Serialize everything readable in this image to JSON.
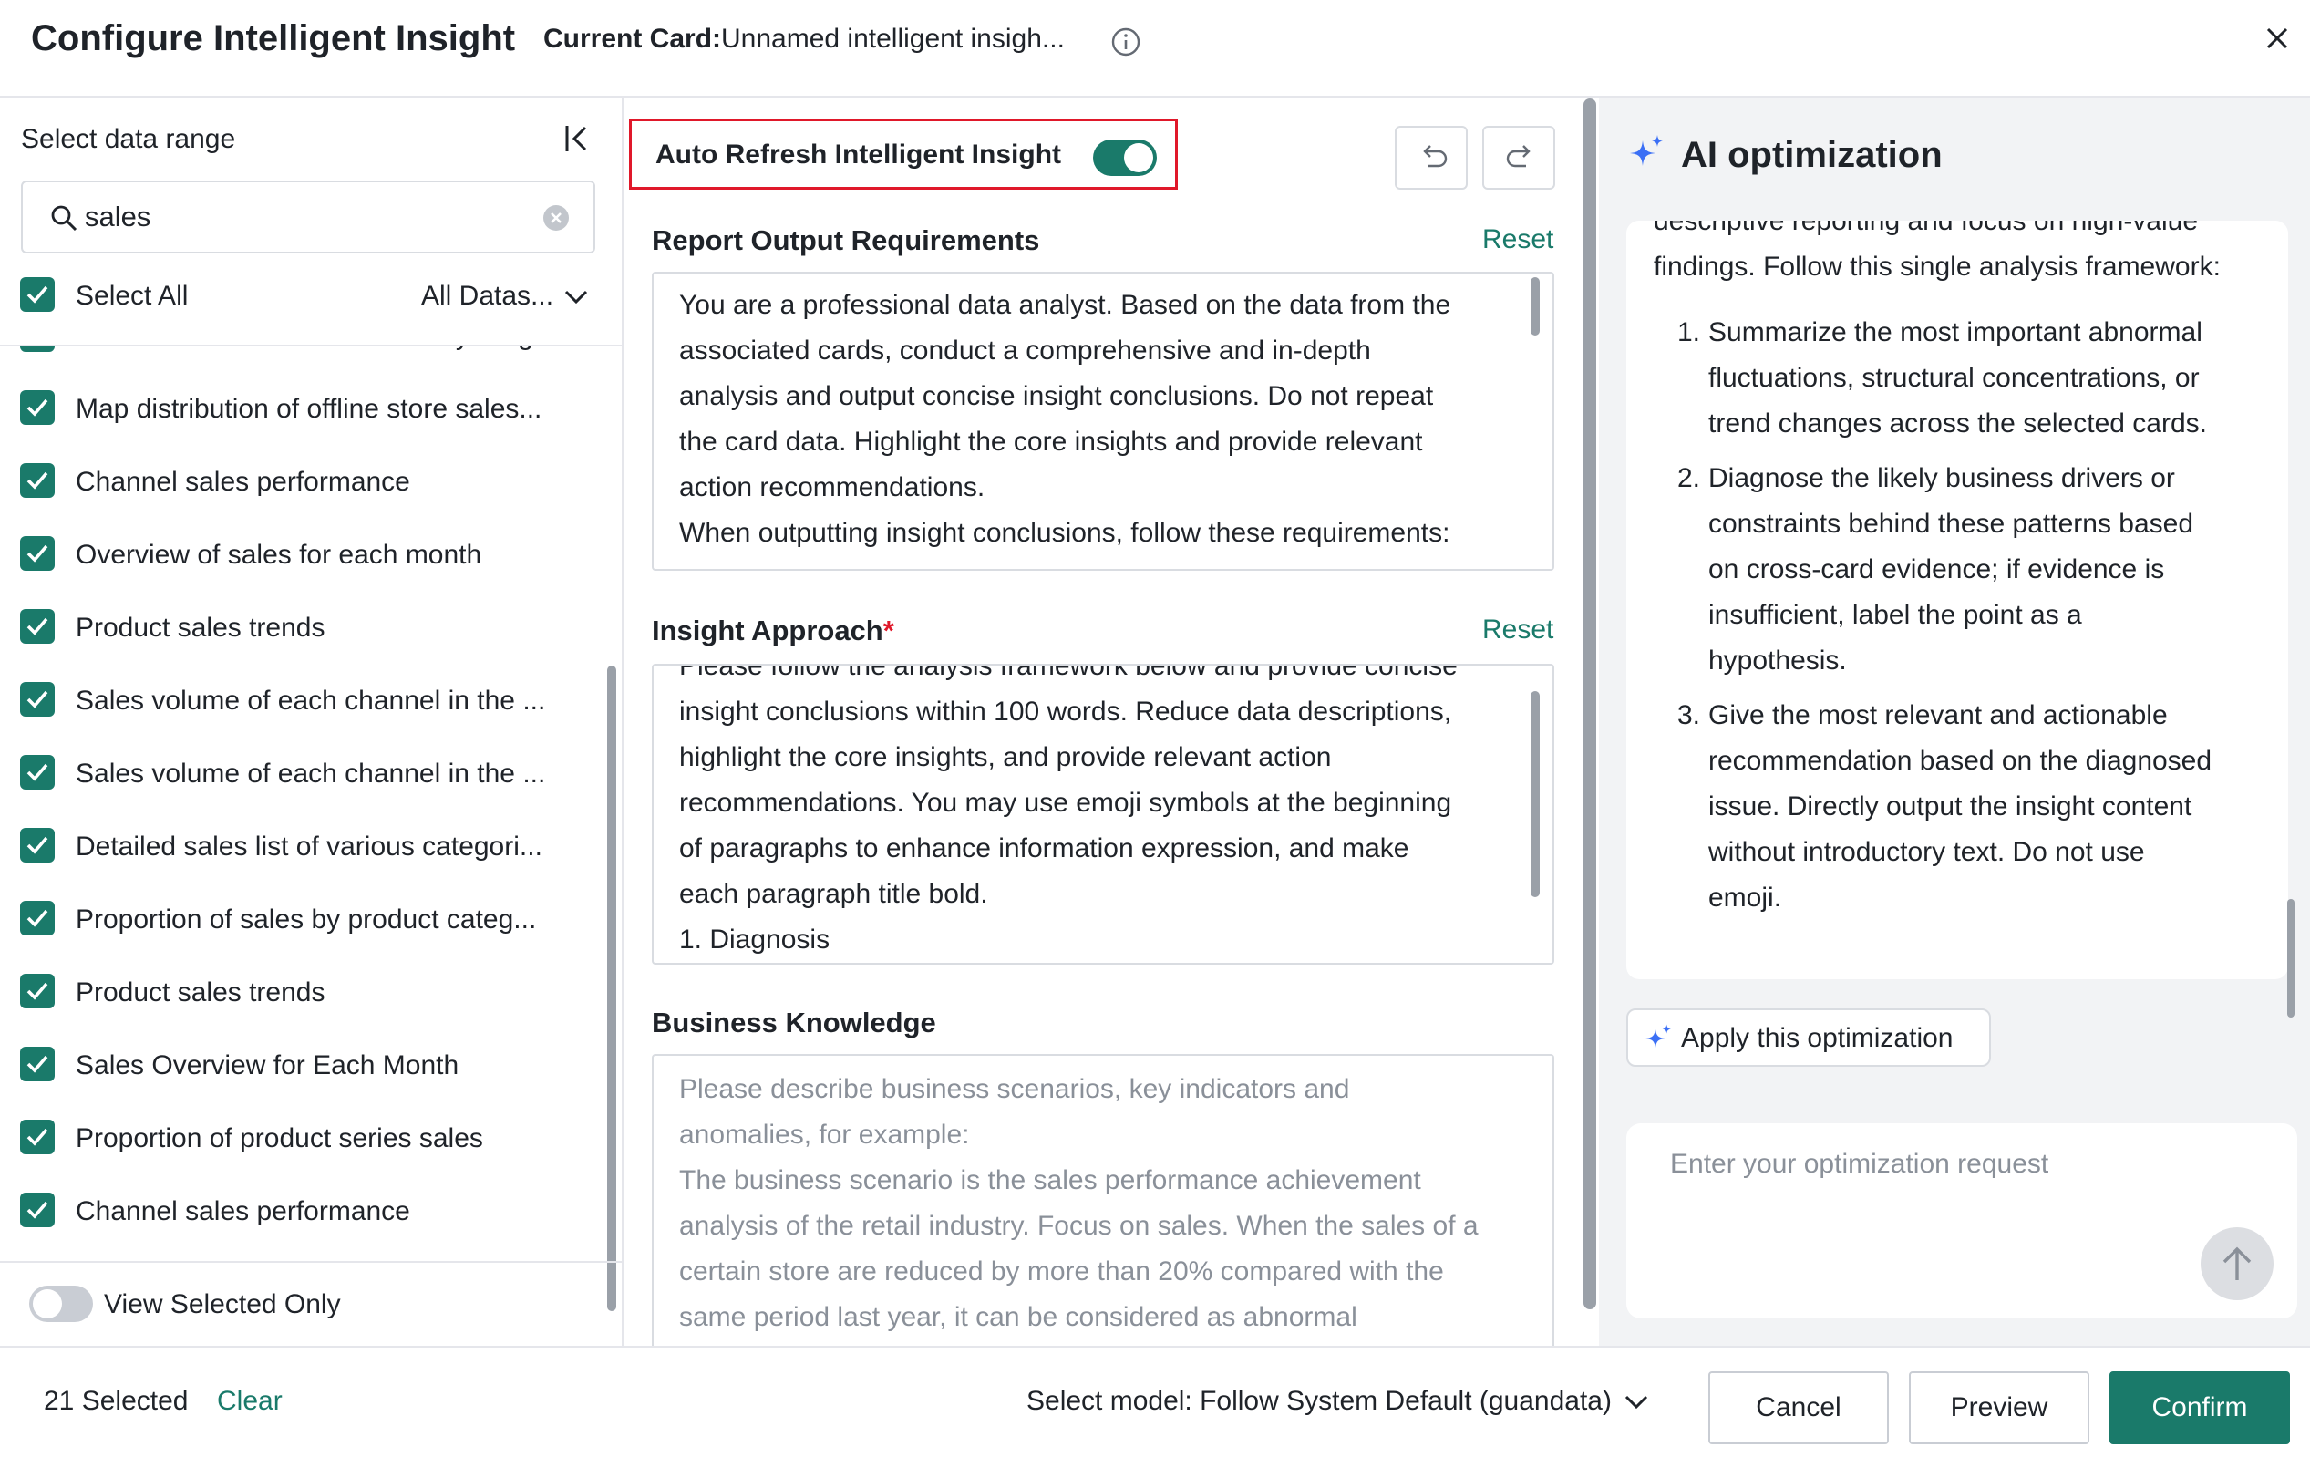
{
  "header": {
    "title": "Configure Intelligent Insight",
    "current_card_label": "Current Card:",
    "current_card_value": "Unnamed intelligent insigh...",
    "info_icon": "info-icon",
    "close_icon": "close-icon"
  },
  "left_panel": {
    "range_label": "Select data range",
    "collapse_icon": "collapse-left-icon",
    "search": {
      "value": "sales",
      "icon": "search-icon",
      "clear_icon": "clear-circle-icon"
    },
    "select_all_label": "Select All",
    "dataset_filter": "All Datas...",
    "items": [
      {
        "label": "Sales Details of Commodities by Frag...",
        "checked": true
      },
      {
        "label": "Map distribution of offline store sales...",
        "checked": true
      },
      {
        "label": "Channel sales performance",
        "checked": true
      },
      {
        "label": "Overview of sales for each month",
        "checked": true
      },
      {
        "label": "Product sales trends",
        "checked": true
      },
      {
        "label": "Sales volume of each channel in the ...",
        "checked": true
      },
      {
        "label": "Sales volume of each channel in the ...",
        "checked": true
      },
      {
        "label": "Detailed sales list of various categori...",
        "checked": true
      },
      {
        "label": "Proportion of sales by product categ...",
        "checked": true
      },
      {
        "label": "Product sales trends",
        "checked": true
      },
      {
        "label": "Sales Overview for Each Month",
        "checked": true
      },
      {
        "label": "Proportion of product series sales",
        "checked": true
      },
      {
        "label": "Channel sales performance",
        "checked": true
      }
    ],
    "view_selected_label": "View Selected Only",
    "view_selected_on": false
  },
  "middle_panel": {
    "auto_refresh_label": "Auto Refresh Intelligent Insight",
    "auto_refresh_on": true,
    "undo_icon": "undo-icon",
    "redo_icon": "redo-icon",
    "report": {
      "title": "Report Output Requirements",
      "reset": "Reset",
      "lines": [
        "You are a professional data analyst. Based on the data from the",
        "associated cards, conduct a comprehensive and in-depth",
        "analysis and output concise insight conclusions. Do not repeat",
        "the card data. Highlight the core insights and provide relevant",
        "action recommendations.",
        "When outputting insight conclusions, follow these requirements:"
      ]
    },
    "approach": {
      "title": "Insight Approach",
      "required_mark": "*",
      "reset": "Reset",
      "lines": [
        "Please follow the analysis framework below and provide concise",
        "insight conclusions within 100 words. Reduce data descriptions,",
        "highlight the core insights, and provide relevant action",
        "recommendations. You may use emoji symbols at the beginning",
        "of paragraphs to enhance information expression, and make",
        "each paragraph title bold.",
        "1. Diagnosis"
      ]
    },
    "knowledge": {
      "title": "Business Knowledge",
      "placeholder_lines": [
        "Please describe business scenarios, key indicators and",
        "anomalies, for example:",
        "The business scenario is the sales performance achievement",
        "analysis of the retail industry. Focus on sales. When the sales of a",
        "certain store are reduced by more than 20% compared with the",
        "same period last year, it can be considered as abnormal"
      ]
    }
  },
  "right_panel": {
    "title": "AI optimization",
    "spark_icon": "sparkle-icon",
    "intro_lines": [
      "descriptive reporting and focus on high-value",
      "findings. Follow this single analysis framework:"
    ],
    "points": [
      {
        "num": "1.",
        "lines": [
          "Summarize the most important abnormal",
          "fluctuations, structural concentrations, or",
          "trend changes across the selected cards."
        ]
      },
      {
        "num": "2.",
        "lines": [
          "Diagnose the likely business drivers or",
          "constraints behind these patterns based",
          "on cross-card evidence; if evidence is",
          "insufficient, label the point as a",
          "hypothesis."
        ]
      },
      {
        "num": "3.",
        "lines": [
          "Give the most relevant and actionable",
          "recommendation based on the diagnosed",
          "issue. Directly output the insight content",
          "without introductory text. Do not use",
          "emoji."
        ]
      }
    ],
    "apply_label": "Apply this optimization",
    "request_placeholder": "Enter your optimization request",
    "send_icon": "arrow-up-icon"
  },
  "footer": {
    "selected_count": "21 Selected",
    "clear": "Clear",
    "model_label": "Select model: Follow System Default (guandata)",
    "cancel": "Cancel",
    "preview": "Preview",
    "confirm": "Confirm"
  },
  "colors": {
    "accent": "#1a7a6a",
    "highlight_border": "#e0182a",
    "sparkle": "#3b6ff5"
  }
}
